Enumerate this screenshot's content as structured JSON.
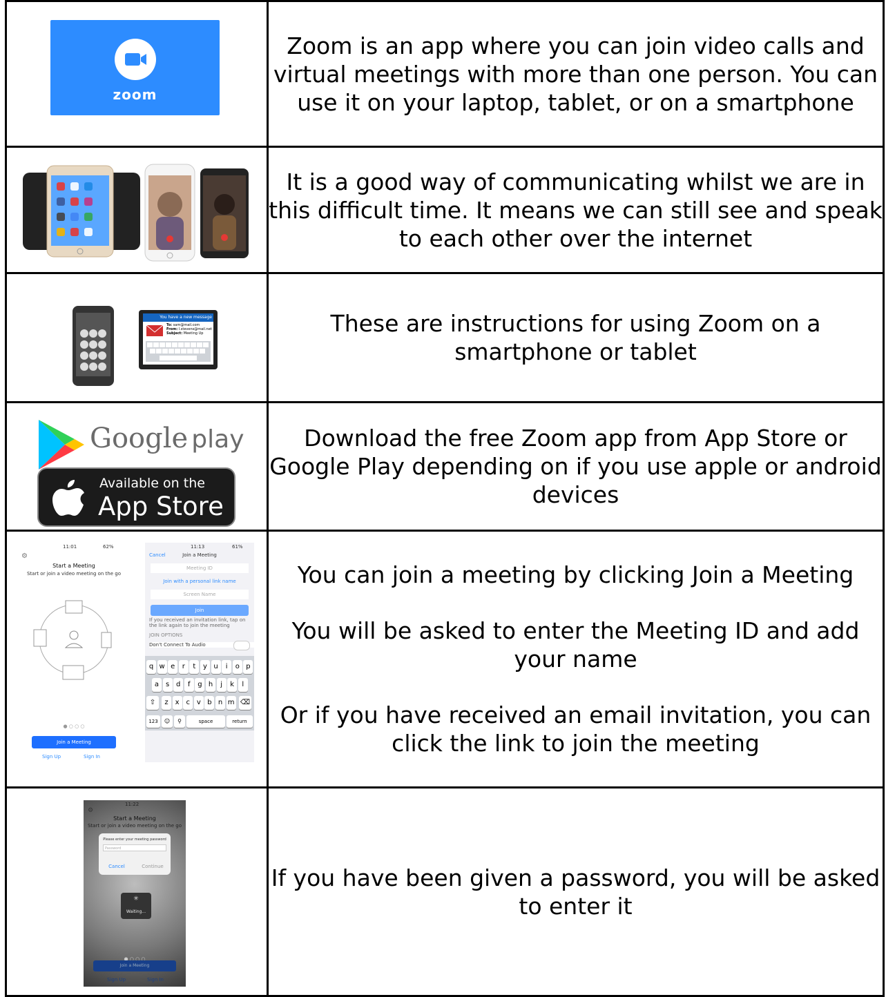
{
  "rows": [
    {
      "id": "zoom-intro",
      "text": "Zoom is an app where you can join video calls and virtual meetings with more than one person. You can use it on your laptop, tablet, or on a smartphone",
      "image": {
        "logo_word": "zoom",
        "brand_color": "#2d8cff"
      }
    },
    {
      "id": "communicating",
      "text": "It is a good way of communicating whilst we are in this difficult time. It means we can still see and speak to each other over the internet"
    },
    {
      "id": "instructions",
      "text": "These are instructions for using Zoom on a smartphone or tablet",
      "image": {
        "email_header": "You have a new message",
        "to_label": "To:",
        "to_value": "sam@mail.com",
        "from_label": "From:",
        "from_value": "l.stevens@mail.net",
        "subject_label": "Subject:",
        "subject_value": "Meeting Up"
      }
    },
    {
      "id": "download",
      "text": "Download the free Zoom app from App Store or Google Play depending on if you use apple or android devices",
      "image": {
        "google_word": "Google",
        "google_play": "play",
        "app_store_small": "Available on the",
        "app_store_big": "App Store"
      }
    },
    {
      "id": "join",
      "paragraphs": [
        "You can join a meeting by clicking Join a Meeting",
        "You will be asked to enter the Meeting ID and add your name",
        "Or if you have received an email invitation, you can click the link to join the meeting"
      ],
      "image": {
        "left": {
          "status_time": "11:01",
          "status_battery": "62%",
          "title": "Start a Meeting",
          "subtitle": "Start or join a video meeting on the go",
          "join_button": "Join a Meeting",
          "sign_up": "Sign Up",
          "sign_in": "Sign In"
        },
        "right": {
          "status_time": "11:13",
          "status_battery": "61%",
          "cancel": "Cancel",
          "title": "Join a Meeting",
          "meeting_id_placeholder": "Meeting ID",
          "personal_link": "Join with a personal link name",
          "screen_name_placeholder": "Screen Name",
          "join_button": "Join",
          "invite_note": "If you received an invitation link, tap on the link again to join the meeting",
          "options_header": "JOIN OPTIONS",
          "audio_option": "Don't Connect To Audio",
          "keys_row1": [
            "q",
            "w",
            "e",
            "r",
            "t",
            "y",
            "u",
            "i",
            "o",
            "p"
          ],
          "keys_row2": [
            "a",
            "s",
            "d",
            "f",
            "g",
            "h",
            "j",
            "k",
            "l"
          ],
          "keys_row3": [
            "z",
            "x",
            "c",
            "v",
            "b",
            "n",
            "m"
          ],
          "key_123": "123",
          "key_space": "space",
          "key_return": "return"
        }
      }
    },
    {
      "id": "password",
      "text": "If you have been given a password, you will be asked to enter it",
      "image": {
        "status_time": "11:22",
        "title": "Start a Meeting",
        "subtitle": "Start or join a video meeting on the go",
        "dialog_title": "Please enter your meeting password",
        "password_placeholder": "Password",
        "cancel": "Cancel",
        "continue": "Continue",
        "waiting": "Waiting...",
        "join_button": "Join a Meeting",
        "sign_up": "Sign Up",
        "sign_in": "Sign In"
      }
    }
  ]
}
